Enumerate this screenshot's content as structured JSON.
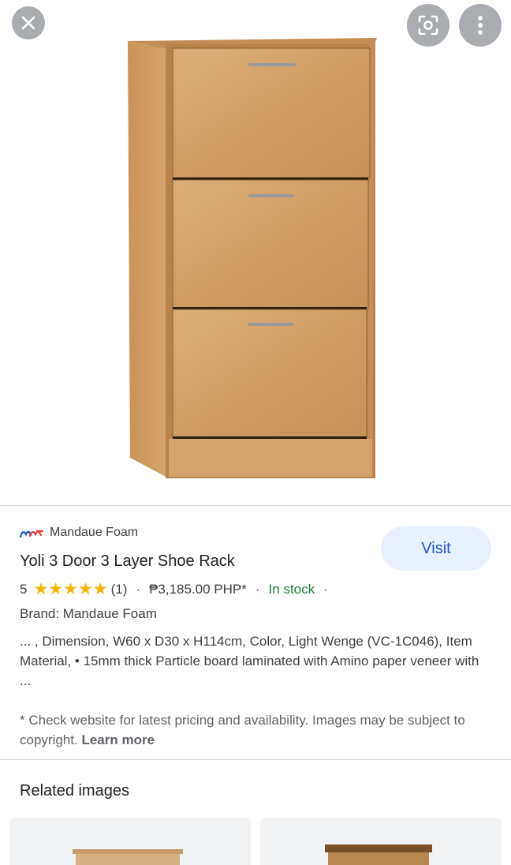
{
  "hero": {
    "close_icon": "close-icon",
    "lens_icon": "lens-icon",
    "more_icon": "more-vert-icon",
    "image_subject": "shoe-rack-cabinet"
  },
  "product": {
    "source": "Mandaue Foam",
    "visit_label": "Visit",
    "title": "Yoli 3 Door 3 Layer Shoe Rack",
    "rating": "5",
    "review_count": "(1)",
    "sep1": "·",
    "price": "₱3,185.00 PHP*",
    "sep2": "·",
    "stock": "In stock",
    "sep3": "·",
    "brand": "Brand: Mandaue Foam",
    "description": "... , Dimension, W60 x D30 x H114cm, Color, Light Wenge (VC-1C046), Item Material, • 15mm thick Particle board laminated with Amino paper veneer with ...",
    "note": "* Check website for latest pricing and availability. Images may be subject to copyright.",
    "learn_more": "Learn more"
  },
  "related": {
    "title": "Related images"
  },
  "colors": {
    "accent": "#1a57c5",
    "stock_green": "#188038",
    "star": "#f4b400",
    "wood": "#d2a06a"
  }
}
